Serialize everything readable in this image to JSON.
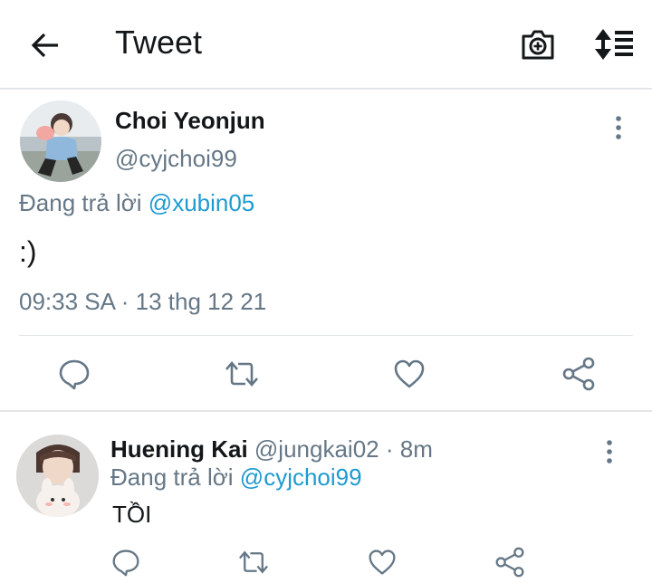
{
  "header": {
    "title": "Tweet",
    "icons": [
      "back-arrow-icon",
      "camera-plus-icon",
      "sort-lines-icon"
    ]
  },
  "main_tweet": {
    "display_name": "Choi Yeonjun",
    "handle": "@cyjchoi99",
    "replying_prefix": "Đang trả lời",
    "replying_to": "@xubin05",
    "text": ":)",
    "timestamp": "09:33 SA · 13 thg 12 21",
    "actions": [
      "reply-icon",
      "retweet-icon",
      "like-icon",
      "share-icon"
    ]
  },
  "reply_tweet": {
    "display_name": "Huening Kai",
    "handle": "@jungkai02",
    "time": "· 8m",
    "replying_prefix": "Đang trả lời",
    "replying_to": "@cyjchoi99",
    "text": "TỒI",
    "actions": [
      "reply-icon",
      "retweet-icon",
      "like-icon",
      "share-icon"
    ]
  },
  "colors": {
    "text_primary": "#14171a",
    "text_secondary": "#657786",
    "link": "#1d9bd1",
    "icon": "#657786",
    "divider": "#e3e6e8"
  }
}
